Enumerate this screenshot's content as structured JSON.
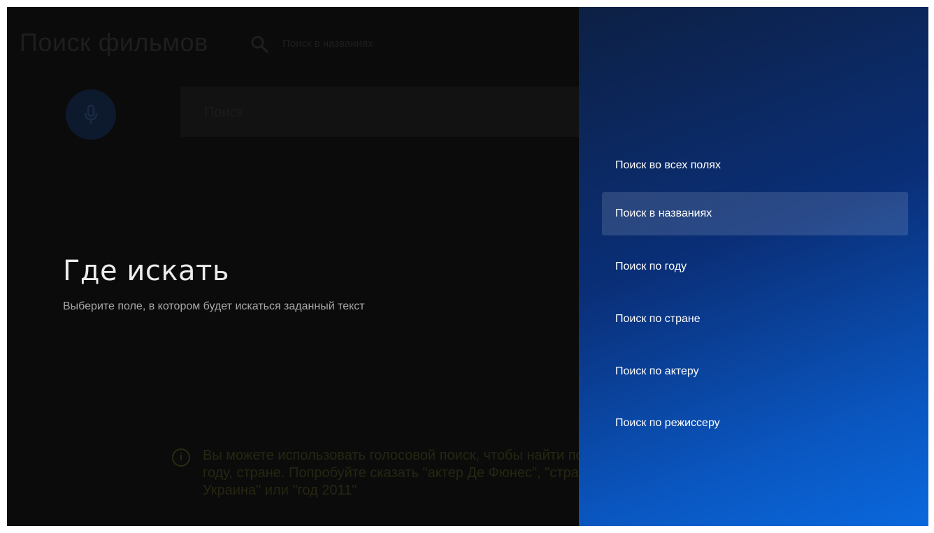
{
  "app": {
    "title": "Поиск фильмов",
    "search_mode": "Поиск в названиях",
    "search_placeholder": "Поиск",
    "info_text": "Вы можете использовать голосовой поиск, чтобы найти по году, стране. Попробуйте сказать \"актер Де Фюнес\", \"страна Украина\" или \"год 2011\""
  },
  "guidance": {
    "title": "Где искать",
    "description": "Выберите поле, в котором будет искаться заданный текст"
  },
  "actions": [
    {
      "label": "Поиск во всех полях",
      "selected": false
    },
    {
      "label": "Поиск в названиях",
      "selected": true
    },
    {
      "label": "Поиск по году",
      "selected": false
    },
    {
      "label": "Поиск по стране",
      "selected": false
    },
    {
      "label": "Поиск по актеру",
      "selected": false
    },
    {
      "label": "Поиск по режиссеру",
      "selected": false
    }
  ],
  "colors": {
    "panel_gradient_start": "#0d2044",
    "panel_gradient_end": "#0a68dc",
    "background": "#0b0b0b"
  },
  "icons": [
    "search-icon",
    "microphone-icon",
    "info-icon"
  ]
}
